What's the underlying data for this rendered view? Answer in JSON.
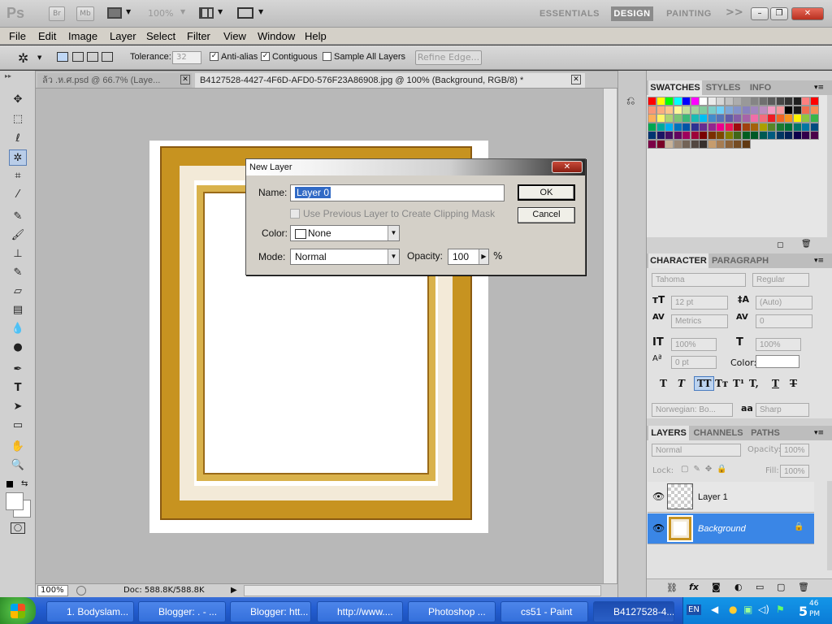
{
  "app": {
    "logo": "Ps",
    "bridge_label": "Br",
    "minibridge_label": "Mb",
    "zoom": "100%",
    "workspaces": [
      "ESSENTIALS",
      "DESIGN",
      "PAINTING"
    ],
    "more": ">>"
  },
  "menu": [
    "File",
    "Edit",
    "Image",
    "Layer",
    "Select",
    "Filter",
    "View",
    "Window",
    "Help"
  ],
  "options": {
    "tolerance_label": "Tolerance:",
    "tolerance_value": "32",
    "antialias_label": "Anti-alias",
    "contiguous_label": "Contiguous",
    "sample_all_label": "Sample All Layers",
    "refine_edge_label": "Refine Edge..."
  },
  "tabs": [
    {
      "label": "ล้ว .ห.ศ.psd @ 66.7% (Laye..."
    },
    {
      "label": "B4127528-4427-4F6D-AFD0-576F23A86908.jpg @ 100% (Background, RGB/8) *"
    }
  ],
  "status": {
    "zoom": "100%",
    "doc": "Doc: 588.8K/588.8K"
  },
  "dialog": {
    "title": "New Layer",
    "name_label": "Name:",
    "name_value": "Layer 0",
    "clipping_label": "Use Previous Layer to Create Clipping Mask",
    "color_label": "Color:",
    "color_value": "None",
    "mode_label": "Mode:",
    "mode_value": "Normal",
    "opacity_label": "Opacity:",
    "opacity_value": "100",
    "percent": "%",
    "ok": "OK",
    "cancel": "Cancel"
  },
  "swatches_panel": {
    "tabs": [
      "SWATCHES",
      "STYLES",
      "INFO"
    ],
    "colors": [
      "#ff0000",
      "#ffff00",
      "#00ff00",
      "#00ffff",
      "#0000ff",
      "#ff00ff",
      "#ffffff",
      "#ebebeb",
      "#d6d6d6",
      "#c2c2c2",
      "#adadad",
      "#999999",
      "#858585",
      "#707070",
      "#5c5c5c",
      "#474747",
      "#333333",
      "#1f1f1f",
      "#ff8080",
      "#ff0000",
      "#f7977a",
      "#f9ad81",
      "#fdc68a",
      "#fff79a",
      "#c4df9b",
      "#a3d39c",
      "#82ca9d",
      "#7bcdc8",
      "#6ecff6",
      "#7ea7d8",
      "#8493ca",
      "#8882be",
      "#a187be",
      "#bc8dbf",
      "#f49ac2",
      "#f6989d",
      "#000000",
      "#1a1a1a",
      "#f26c4f",
      "#f68e56",
      "#fbaf5d",
      "#fff568",
      "#acd372",
      "#7cc576",
      "#3bb878",
      "#1abbb4",
      "#00bff3",
      "#438ccb",
      "#5574b9",
      "#605ca8",
      "#855fa8",
      "#a763a8",
      "#f06ea9",
      "#f26d7d",
      "#ed1c24",
      "#f26522",
      "#f7941d",
      "#fff200",
      "#8dc63f",
      "#39b54a",
      "#00a651",
      "#00a99d",
      "#00aeef",
      "#0072bc",
      "#0054a6",
      "#2e3192",
      "#662d91",
      "#92278f",
      "#ec008c",
      "#ed145b",
      "#9e0b0f",
      "#a0410d",
      "#a36209",
      "#aba000",
      "#598527",
      "#1a7b30",
      "#007236",
      "#00746b",
      "#0076a3",
      "#004b80",
      "#003471",
      "#1b1464",
      "#440e62",
      "#630460",
      "#9e005d",
      "#9e0039",
      "#790000",
      "#7b2e00",
      "#7d4900",
      "#827b00",
      "#406618",
      "#005e20",
      "#005826",
      "#005952",
      "#005b7f",
      "#003663",
      "#002157",
      "#0d004c",
      "#32004b",
      "#4b0049",
      "#7b0046",
      "#7a0026",
      "#c7b299",
      "#998675",
      "#736357",
      "#534741",
      "#37302d",
      "#c69c6d",
      "#a67c52",
      "#8c6239",
      "#754c24",
      "#603913"
    ]
  },
  "character_panel": {
    "tabs": [
      "CHARACTER",
      "PARAGRAPH"
    ],
    "font_family": "Tahoma",
    "font_style": "Regular",
    "size": "12 pt",
    "leading": "(Auto)",
    "kerning": "Metrics",
    "tracking": "0",
    "vscale": "100%",
    "hscale": "100%",
    "baseline": "0 pt",
    "color_label": "Color:",
    "language": "Norwegian: Bo...",
    "aa_label": "aa",
    "antialias": "Sharp"
  },
  "layers_panel": {
    "tabs": [
      "LAYERS",
      "CHANNELS",
      "PATHS"
    ],
    "blend": "Normal",
    "opacity_label": "Opacity:",
    "opacity_value": "100%",
    "lock_label": "Lock:",
    "fill_label": "Fill:",
    "fill_value": "100%",
    "layers": [
      {
        "name": "Layer 1",
        "selected": false
      },
      {
        "name": "Background",
        "selected": true
      }
    ]
  },
  "taskbar": {
    "items": [
      "1. Bodyslam...",
      "Blogger: . - ...",
      "Blogger: htt...",
      "http://www....",
      "Photoshop ...",
      "cs51 - Paint",
      "B4127528-4..."
    ],
    "lang": "EN",
    "time_top": "46",
    "time_hour": "5",
    "time_ampm": "PM"
  }
}
